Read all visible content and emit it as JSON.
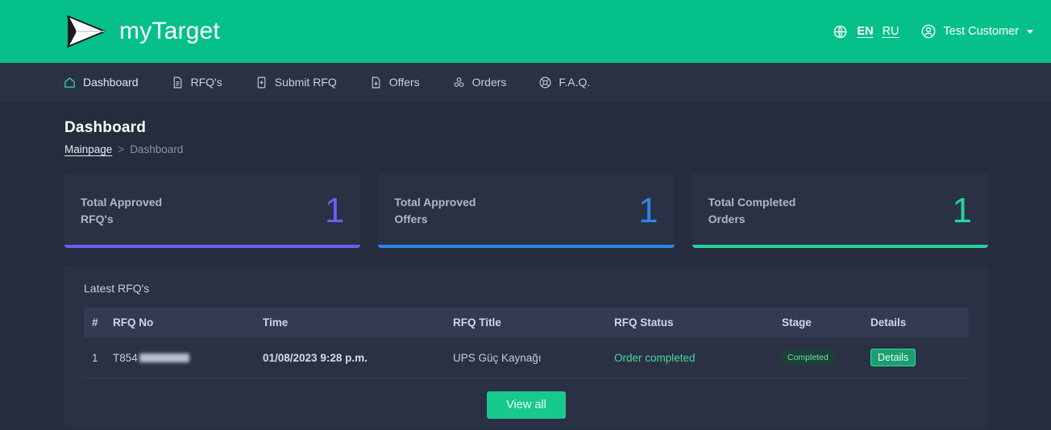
{
  "header": {
    "brand_name": "myTarget",
    "brand_logo_icon": "paper-plane-logo",
    "globe_icon": "globe-icon",
    "lang_en": "EN",
    "lang_ru": "RU",
    "user_icon": "user-circle-icon",
    "user_name": "Test Customer",
    "caret_icon": "chevron-down-icon",
    "bg_color": "#06c08a"
  },
  "nav": {
    "items": [
      {
        "label": "Dashboard",
        "icon": "home-icon",
        "active": true
      },
      {
        "label": "RFQ's",
        "icon": "document-list-icon",
        "active": false
      },
      {
        "label": "Submit RFQ",
        "icon": "document-plus-icon",
        "active": false
      },
      {
        "label": "Offers",
        "icon": "document-down-icon",
        "active": false
      },
      {
        "label": "Orders",
        "icon": "boxes-icon",
        "active": false
      },
      {
        "label": "F.A.Q.",
        "icon": "lifebuoy-icon",
        "active": false
      }
    ]
  },
  "page": {
    "title": "Dashboard",
    "breadcrumb": {
      "link": "Mainpage",
      "separator": ">",
      "current": "Dashboard"
    }
  },
  "cards": [
    {
      "label": "Total Approved RFQ's",
      "value": "1",
      "accent": "#6f5cf0"
    },
    {
      "label": "Total Approved Offers",
      "value": "1",
      "accent": "#2b86e8"
    },
    {
      "label": "Total Completed Orders",
      "value": "1",
      "accent": "#22d49a"
    }
  ],
  "panel": {
    "title": "Latest RFQ's",
    "columns": [
      "#",
      "RFQ No",
      "Time",
      "RFQ Title",
      "RFQ Status",
      "Stage",
      "Details"
    ],
    "rows": [
      {
        "num": "1",
        "rfq_no": "T854",
        "rfq_no_redacted": true,
        "time": "01/08/2023 9:28 p.m.",
        "title": "UPS Güç Kaynağı",
        "status": "Order completed",
        "stage": "Completed",
        "details": "Details"
      }
    ],
    "view_all": "View all"
  }
}
